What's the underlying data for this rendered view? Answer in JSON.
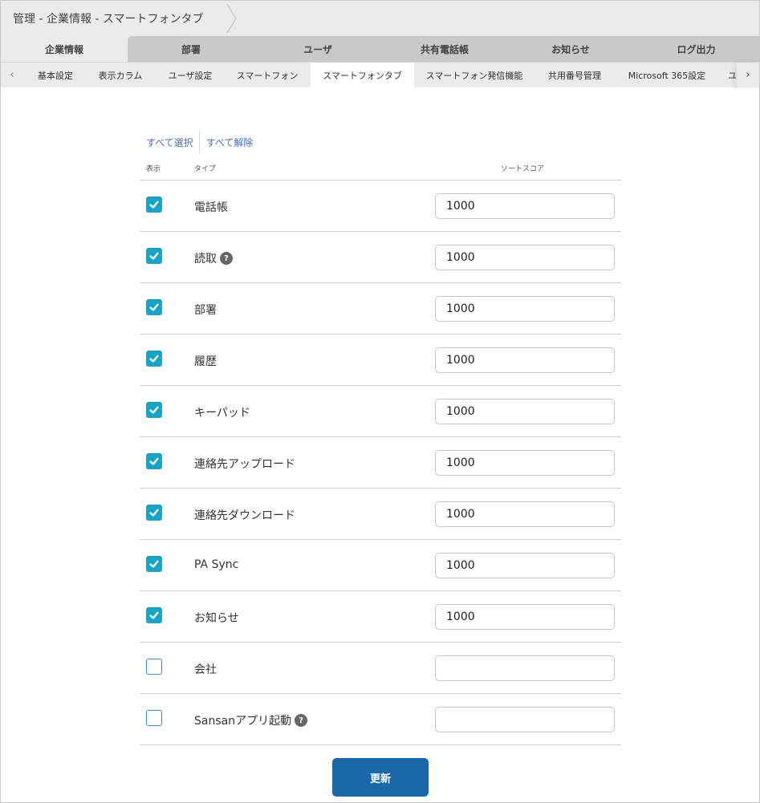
{
  "breadcrumb": {
    "text": "管理 - 企業情報 - スマートフォンタブ"
  },
  "main_tabs": [
    {
      "label": "企業情報",
      "active": true
    },
    {
      "label": "部署"
    },
    {
      "label": "ユーザ"
    },
    {
      "label": "共有電話帳"
    },
    {
      "label": "お知らせ"
    },
    {
      "label": "ログ出力"
    }
  ],
  "sub_tabs": [
    {
      "label": "基本設定"
    },
    {
      "label": "表示カラム"
    },
    {
      "label": "ユーザ設定"
    },
    {
      "label": "スマートフォン"
    },
    {
      "label": "スマートフォンタブ",
      "active": true
    },
    {
      "label": "スマートフォン発信機能"
    },
    {
      "label": "共用番号管理"
    },
    {
      "label": "Microsoft 365設定"
    },
    {
      "label": "ユ"
    }
  ],
  "sub_nav": {
    "prev": "‹",
    "next": "›"
  },
  "select_all": "すべて選択",
  "deselect_all": "すべて解除",
  "table_header": {
    "show": "表示",
    "type": "タイプ",
    "score": "ソートスコア"
  },
  "rows": [
    {
      "label": "電話帳",
      "checked": true,
      "score": "1000",
      "help": false
    },
    {
      "label": "読取",
      "checked": true,
      "score": "1000",
      "help": true
    },
    {
      "label": "部署",
      "checked": true,
      "score": "1000",
      "help": false
    },
    {
      "label": "履歴",
      "checked": true,
      "score": "1000",
      "help": false
    },
    {
      "label": "キーパッド",
      "checked": true,
      "score": "1000",
      "help": false
    },
    {
      "label": "連絡先アップロード",
      "checked": true,
      "score": "1000",
      "help": false
    },
    {
      "label": "連絡先ダウンロード",
      "checked": true,
      "score": "1000",
      "help": false
    },
    {
      "label": "PA Sync",
      "checked": true,
      "score": "1000",
      "help": false
    },
    {
      "label": "お知らせ",
      "checked": true,
      "score": "1000",
      "help": false
    },
    {
      "label": "会社",
      "checked": false,
      "score": "",
      "help": false
    },
    {
      "label": "Sansanアプリ起動",
      "checked": false,
      "score": "",
      "help": true
    }
  ],
  "update_button": "更新",
  "colors": {
    "checkbox": "#1aa3c4",
    "button": "#1a68a8",
    "link": "#4a6fb0"
  }
}
